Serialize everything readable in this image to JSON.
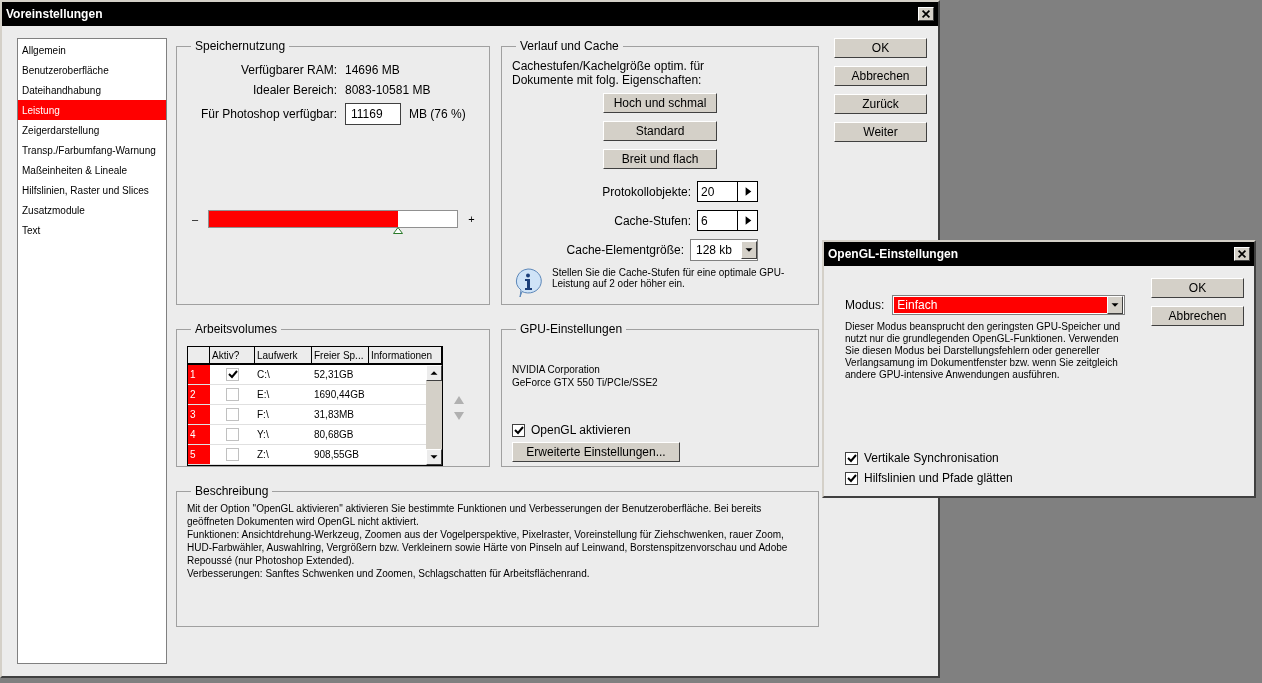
{
  "window": {
    "title": "Voreinstellungen"
  },
  "sidebar": {
    "items": [
      {
        "label": "Allgemein",
        "selected": false
      },
      {
        "label": "Benutzeroberfläche",
        "selected": false
      },
      {
        "label": "Dateihandhabung",
        "selected": false
      },
      {
        "label": "Leistung",
        "selected": true
      },
      {
        "label": "Zeigerdarstellung",
        "selected": false
      },
      {
        "label": "Transp./Farbumfang-Warnung",
        "selected": false
      },
      {
        "label": "Maßeinheiten & Lineale",
        "selected": false
      },
      {
        "label": "Hilfslinien, Raster und Slices",
        "selected": false
      },
      {
        "label": "Zusatzmodule",
        "selected": false
      },
      {
        "label": "Text",
        "selected": false
      }
    ]
  },
  "memory": {
    "title": "Speichernutzung",
    "rows": [
      {
        "label": "Verfügbarer RAM:",
        "value": "14696 MB"
      },
      {
        "label": "Idealer Bereich:",
        "value": "8083-10581 MB"
      }
    ],
    "available": {
      "label": "Für Photoshop verfügbar:",
      "value": "11169",
      "unit": "MB (76 %)"
    },
    "slider": {
      "min": "–",
      "max": "+",
      "level": 0.76
    }
  },
  "history": {
    "title": "Verlauf und Cache",
    "intro": "Cachestufen/Kachelgröße optim. für Dokumente mit folg. Eigenschaften:",
    "presets": [
      "Hoch und schmal",
      "Standard",
      "Breit und flach"
    ],
    "fields": [
      {
        "kind": "stepper",
        "label": "Protokollobjekte:",
        "value": "20"
      },
      {
        "kind": "stepper",
        "label": "Cache-Stufen:",
        "value": "6"
      },
      {
        "kind": "dropdown",
        "label": "Cache-Elementgröße:",
        "value": "128 kb"
      }
    ],
    "info": "Stellen Sie die Cache-Stufen für eine optimale GPU-Leistung auf 2 oder höher ein."
  },
  "volumes": {
    "title": "Arbeitsvolumes",
    "columns": [
      "Aktiv?",
      "Laufwerk",
      "Freier Sp...",
      "Informationen"
    ],
    "rows": [
      {
        "index": "1",
        "checked": true,
        "drive": "C:\\",
        "free": "52,31GB"
      },
      {
        "index": "2",
        "checked": false,
        "drive": "E:\\",
        "free": "1690,44GB"
      },
      {
        "index": "3",
        "checked": false,
        "drive": "F:\\",
        "free": "31,83MB"
      },
      {
        "index": "4",
        "checked": false,
        "drive": "Y:\\",
        "free": "80,68GB"
      },
      {
        "index": "5",
        "checked": false,
        "drive": "Z:\\",
        "free": "908,55GB"
      }
    ]
  },
  "gpu": {
    "title": "GPU-Einstellungen",
    "vendor": "NVIDIA Corporation",
    "renderer": "GeForce GTX 550 Ti/PCIe/SSE2",
    "opengl": {
      "label": "OpenGL aktivieren",
      "checked": true
    },
    "advanced_button": "Erweiterte Einstellungen..."
  },
  "description": {
    "title": "Beschreibung",
    "paragraphs": [
      "Mit der Option \"OpenGL aktivieren\" aktivieren Sie bestimmte Funktionen und Verbesserungen der Benutzeroberfläche. Bei bereits geöffneten Dokumenten wird OpenGL nicht aktiviert.",
      "Funktionen: Ansichtdrehung-Werkzeug, Zoomen aus der Vogelperspektive, Pixelraster, Voreinstellung für Ziehschwenken, rauer Zoom, HUD-Farbwähler, Auswahlring, Vergrößern bzw. Verkleinern sowie Härte von Pinseln auf Leinwand, Borstenspitzenvorschau und Adobe Repoussé (nur Photoshop Extended).",
      "Verbesserungen: Sanftes Schwenken und Zoomen, Schlagschatten für Arbeitsflächenrand."
    ]
  },
  "buttons": [
    "OK",
    "Abbrechen",
    "Zurück",
    "Weiter"
  ],
  "opengl_dialog": {
    "title": "OpenGL-Einstellungen",
    "mode": {
      "label": "Modus:",
      "value": "Einfach"
    },
    "text": "Dieser Modus beansprucht den geringsten GPU-Speicher und nutzt nur die grundlegenden OpenGL-Funktionen. Verwenden Sie diesen Modus bei Darstellungsfehlern oder genereller Verlangsamung im Dokumentfenster bzw. wenn Sie zeitgleich andere GPU-intensive Anwendungen ausführen.",
    "options": [
      {
        "label": "Vertikale Synchronisation",
        "checked": true
      },
      {
        "label": "Hilfslinien und Pfade glätten",
        "checked": true
      }
    ],
    "buttons": [
      "OK",
      "Abbrechen"
    ]
  }
}
